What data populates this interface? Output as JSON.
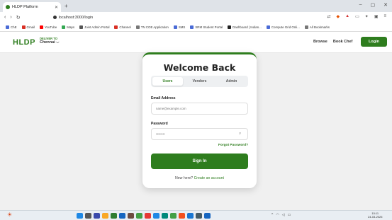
{
  "browser": {
    "tab_title": "HLDP Platform",
    "new_tab_icon": "plus-icon",
    "url": "localhost:3000/login",
    "bookmarks": [
      "ChE",
      "Gmail",
      "YouTube",
      "Maps",
      "Joint Admin Portal",
      "Channel",
      "TN COE Application",
      "SMS",
      "SRM Student Portal",
      "Dashboard | Indian...",
      "Compute Grid Onli...",
      "All Bookmarks"
    ],
    "bookmark_colors": [
      "#4a6bd6",
      "#d93025",
      "#ff0000",
      "#34a853",
      "#555555",
      "#d93025",
      "#777777",
      "#4a6bd6",
      "#4a6bd6",
      "#222222",
      "#4a6bd6",
      "#777777"
    ]
  },
  "header": {
    "logo": "HLDP",
    "deliver_label": "DELIVER TO",
    "city": "Chennai ⌵",
    "nav": [
      "Browse",
      "Book Chef"
    ],
    "login_label": "Login"
  },
  "login": {
    "title": "Welcome Back",
    "roles": [
      "Users",
      "Vendors",
      "Admin"
    ],
    "active_role": "Users",
    "email_label": "Email Address",
    "email_placeholder": "name@example.com",
    "password_label": "Password",
    "password_value": "••••••••",
    "forgot_label": "Forgot Password?",
    "signin_label": "Sign In",
    "new_here_text": "New here?",
    "create_account_label": "Create an account"
  },
  "taskbar": {
    "icon_colors": [
      "#1e88e5",
      "#555555",
      "#3949ab",
      "#f9a825",
      "#2e7d32",
      "#1565c0",
      "#6d4c41",
      "#43a047",
      "#e53935",
      "#1e88e5",
      "#00897b",
      "#43a047",
      "#f4511e",
      "#1976d2",
      "#455a64",
      "#1565c0"
    ],
    "time": "15:11",
    "date": "24-03-2025"
  },
  "colors": {
    "brand": "#2e7d1e"
  }
}
